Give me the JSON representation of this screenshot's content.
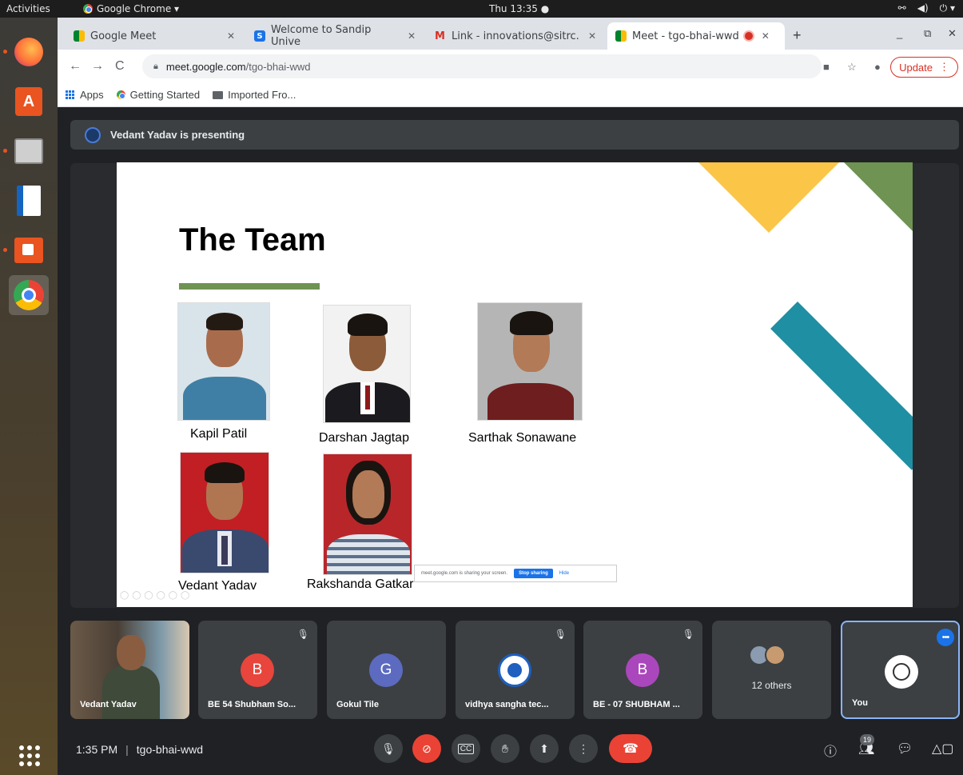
{
  "topbar": {
    "activities": "Activities",
    "app_name": "Google Chrome ▾",
    "clock": "Thu 13:35 ●"
  },
  "tabs": [
    {
      "label": "Google Meet"
    },
    {
      "label": "Welcome to Sandip Unive"
    },
    {
      "label": "Link - innovations@sitrc."
    },
    {
      "label": "Meet - tgo-bhai-wwd"
    }
  ],
  "toolbar": {
    "url_host": "meet.google.com",
    "url_path": "/tgo-bhai-wwd",
    "update_label": "Update"
  },
  "bookmarks": [
    {
      "label": "Apps"
    },
    {
      "label": "Getting Started"
    },
    {
      "label": "Imported Fro..."
    }
  ],
  "meet": {
    "presenting_text": "Vedant Yadav is presenting",
    "slide": {
      "title": "The Team",
      "members": [
        {
          "name": "Kapil Patil"
        },
        {
          "name": "Darshan Jagtap"
        },
        {
          "name": "Sarthak Sonawane"
        },
        {
          "name": "Vedant Yadav"
        },
        {
          "name": "Rakshanda Gatkar"
        }
      ],
      "share_notice": "meet.google.com is sharing your screen.",
      "stop_sharing": "Stop sharing",
      "hide": "Hide"
    },
    "tiles": [
      {
        "name": "Vedant Yadav"
      },
      {
        "name": "BE 54 Shubham So...",
        "initial": "B",
        "color": "#e8453c"
      },
      {
        "name": "Gokul Tile",
        "initial": "G",
        "color": "#5c6bc0"
      },
      {
        "name": "vidhya sangha tec..."
      },
      {
        "name": "BE - 07 SHUBHAM ...",
        "initial": "B",
        "color": "#ab47bc"
      },
      {
        "name": "12 others"
      },
      {
        "name": "You"
      }
    ],
    "bottom": {
      "time": "1:35 PM",
      "separator": "|",
      "meeting_code": "tgo-bhai-wwd",
      "participant_count": "19"
    }
  },
  "colors": {
    "accent": "#1a73e8",
    "danger": "#ea4335",
    "slide_green": "#6f9352",
    "slide_yellow": "#fbc548",
    "slide_teal": "#1f8fa3"
  }
}
